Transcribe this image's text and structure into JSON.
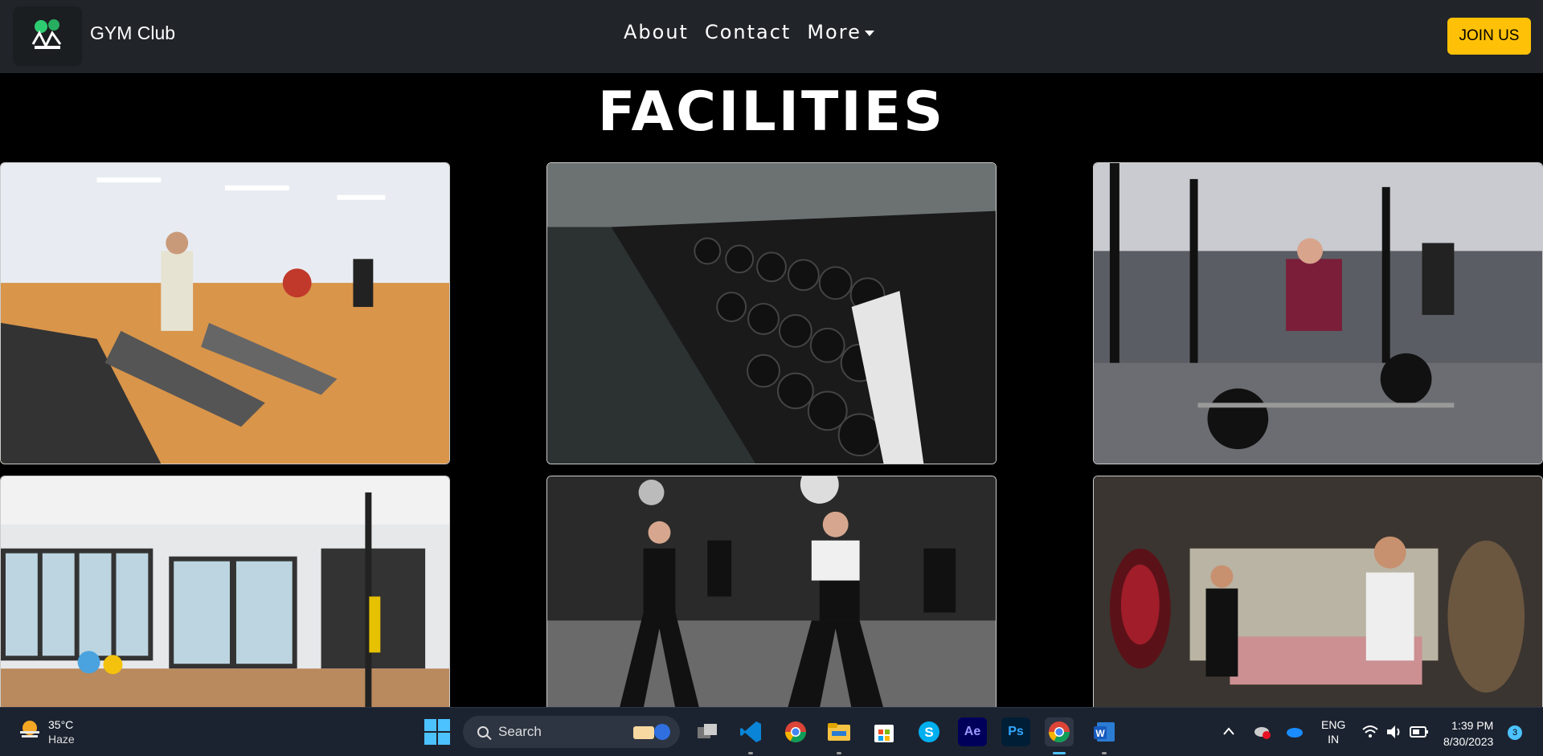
{
  "navbar": {
    "brand": "GYM Club",
    "links": [
      "About",
      "Contact",
      "More"
    ],
    "join_label": "JOIN US",
    "accent": "#ffc107"
  },
  "page": {
    "title": "FACILITIES",
    "images": [
      {
        "name": "treadmill-area-image"
      },
      {
        "name": "dumbbell-rack-image"
      },
      {
        "name": "weightlifting-area-image"
      },
      {
        "name": "fitness-studio-image"
      },
      {
        "name": "group-class-image"
      },
      {
        "name": "boxing-area-image"
      }
    ]
  },
  "taskbar": {
    "weather_temp": "35°C",
    "weather_cond": "Haze",
    "search_placeholder": "Search",
    "lang_1": "ENG",
    "lang_2": "IN",
    "time": "1:39 PM",
    "date": "8/30/2023",
    "notifications": "3",
    "apps": [
      "task-view",
      "vscode",
      "chrome",
      "file-explorer",
      "microsoft-store",
      "skype",
      "after-effects",
      "photoshop",
      "chrome-active",
      "word"
    ]
  }
}
